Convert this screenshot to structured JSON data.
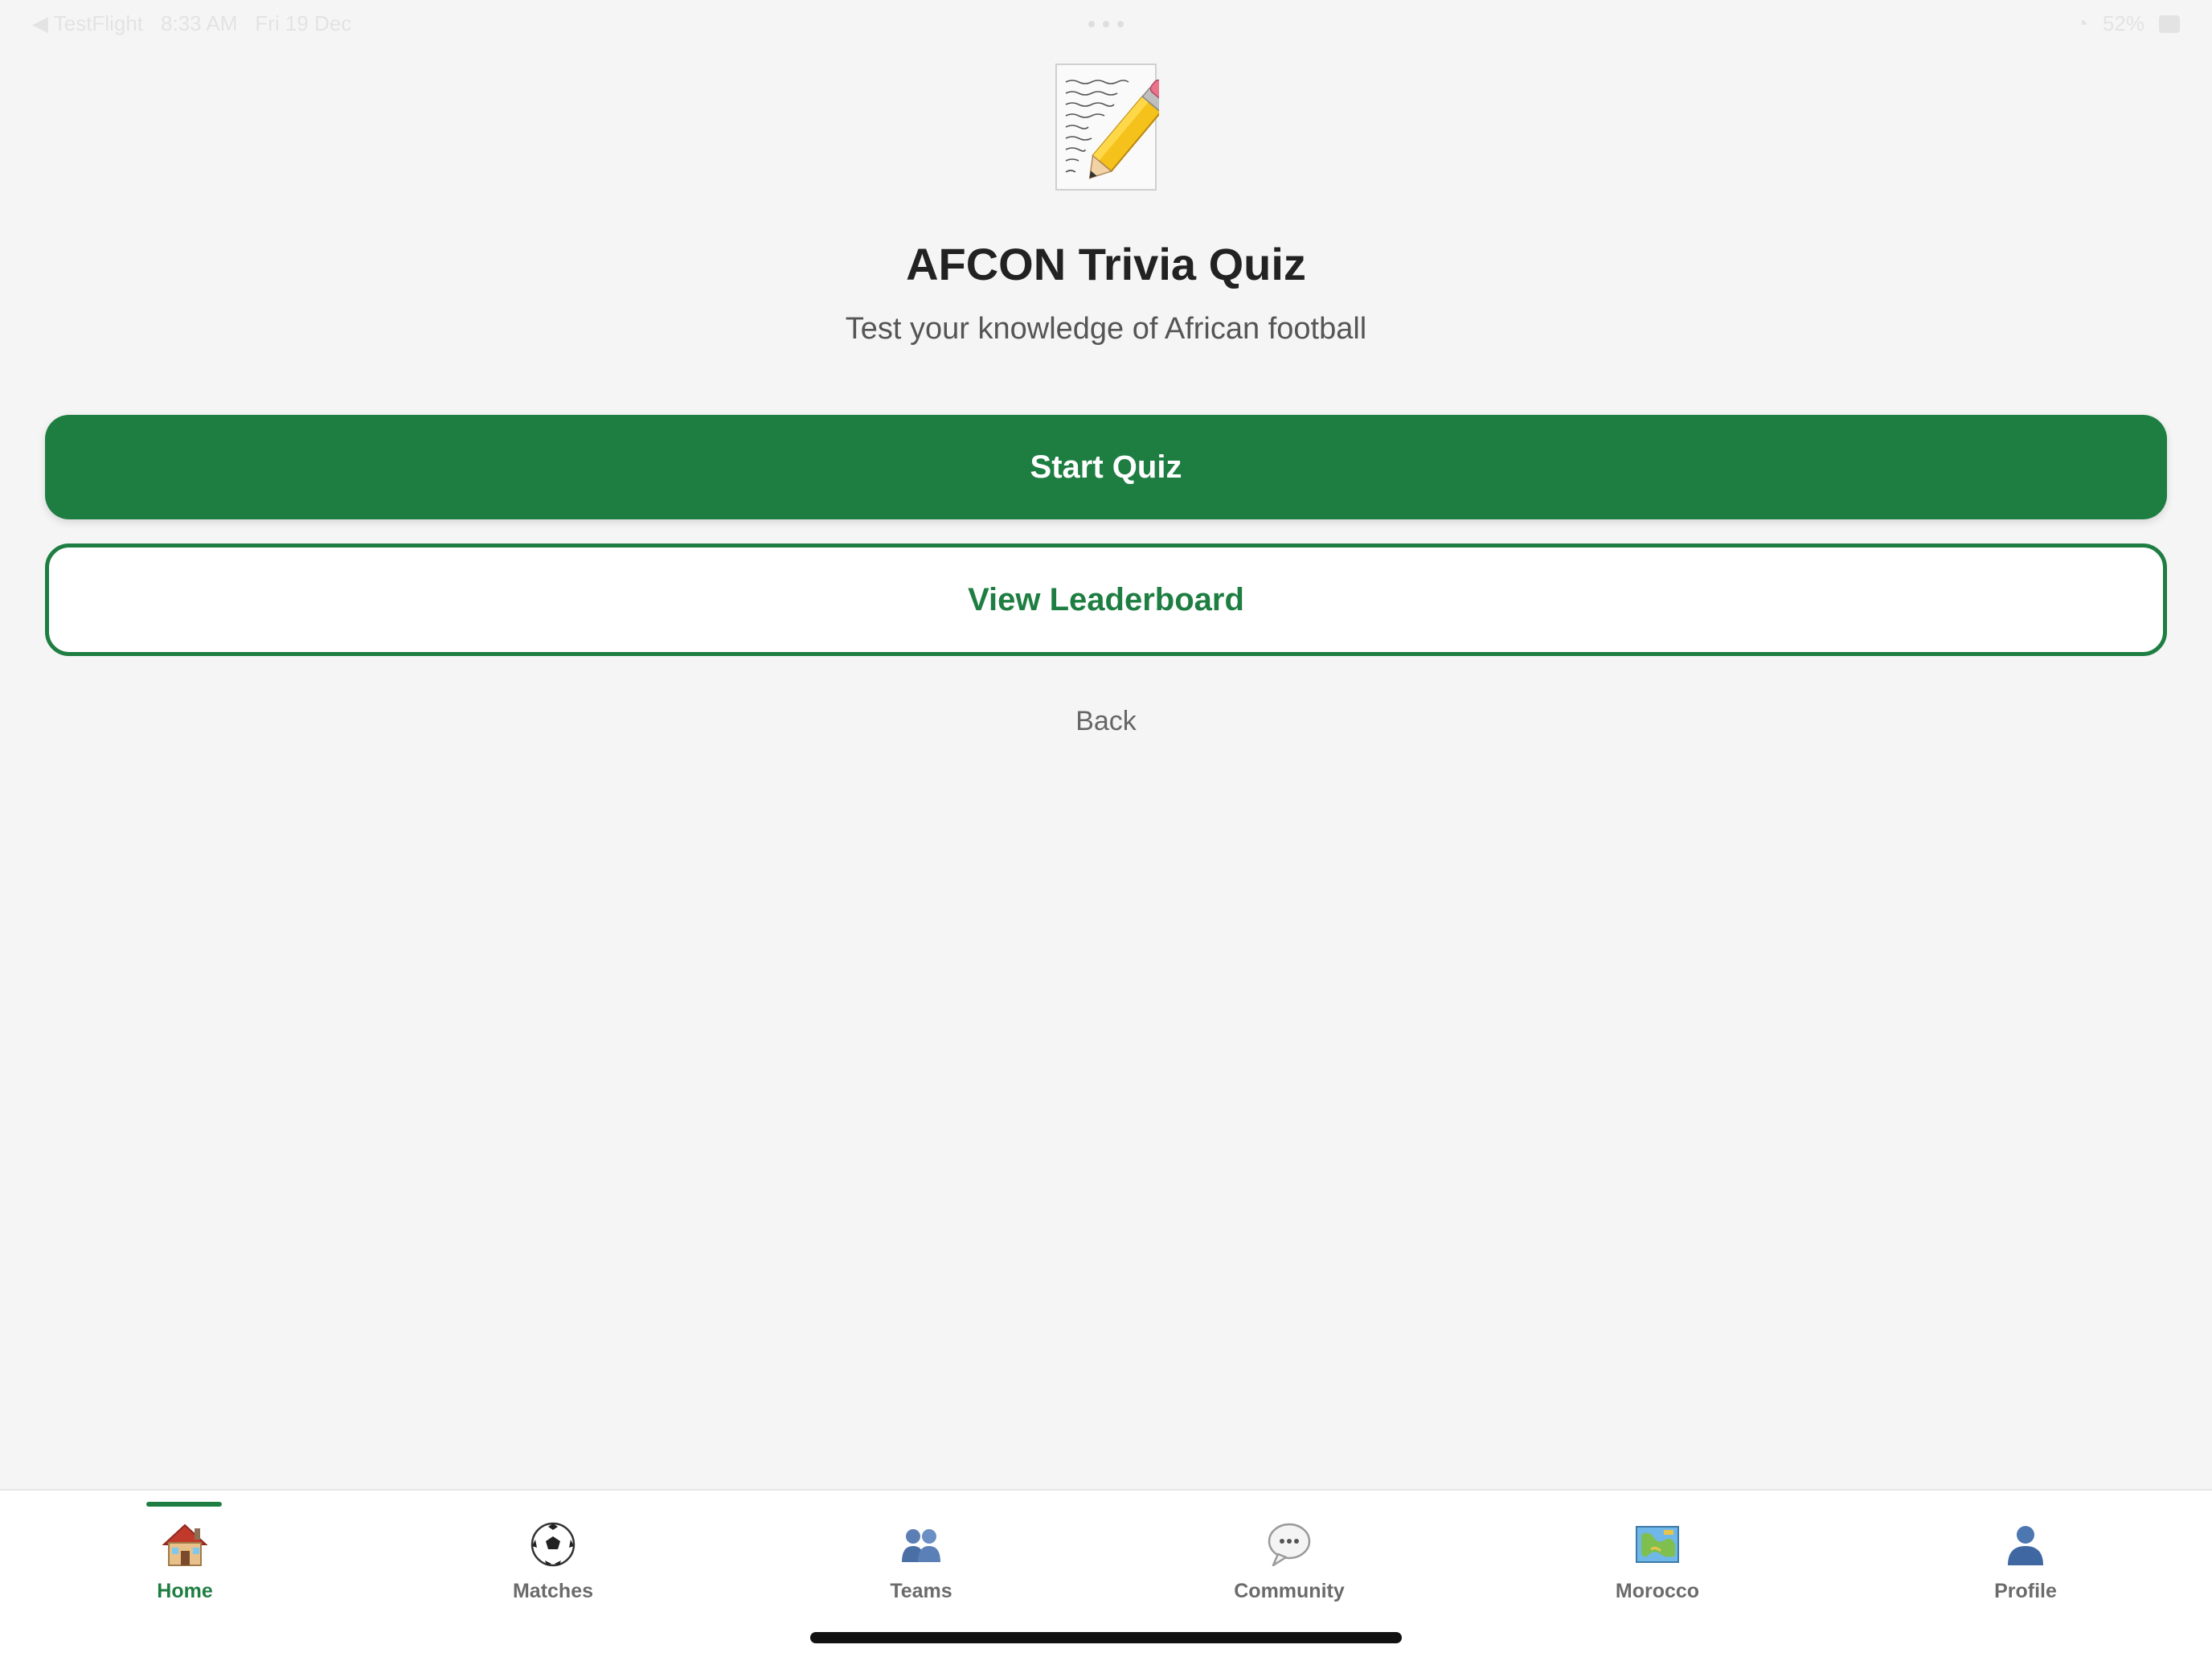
{
  "status_bar": {
    "back_app": "◀ TestFlight",
    "time": "8:33 AM",
    "date": "Fri 19 Dec",
    "battery": "52%"
  },
  "header": {
    "icon": "memo-pencil-icon",
    "title": "AFCON Trivia Quiz",
    "subtitle": "Test your knowledge of African football"
  },
  "actions": {
    "start_label": "Start Quiz",
    "leaderboard_label": "View Leaderboard",
    "back_label": "Back"
  },
  "tabs": [
    {
      "label": "Home",
      "icon": "house-icon",
      "active": true
    },
    {
      "label": "Matches",
      "icon": "soccer-ball-icon",
      "active": false
    },
    {
      "label": "Teams",
      "icon": "people-icon",
      "active": false
    },
    {
      "label": "Community",
      "icon": "speech-bubble-icon",
      "active": false
    },
    {
      "label": "Morocco",
      "icon": "map-icon",
      "active": false
    },
    {
      "label": "Profile",
      "icon": "person-icon",
      "active": false
    }
  ],
  "colors": {
    "accent": "#1e7e42",
    "background": "#f5f5f5",
    "tab_inactive": "#6b6b6b"
  }
}
